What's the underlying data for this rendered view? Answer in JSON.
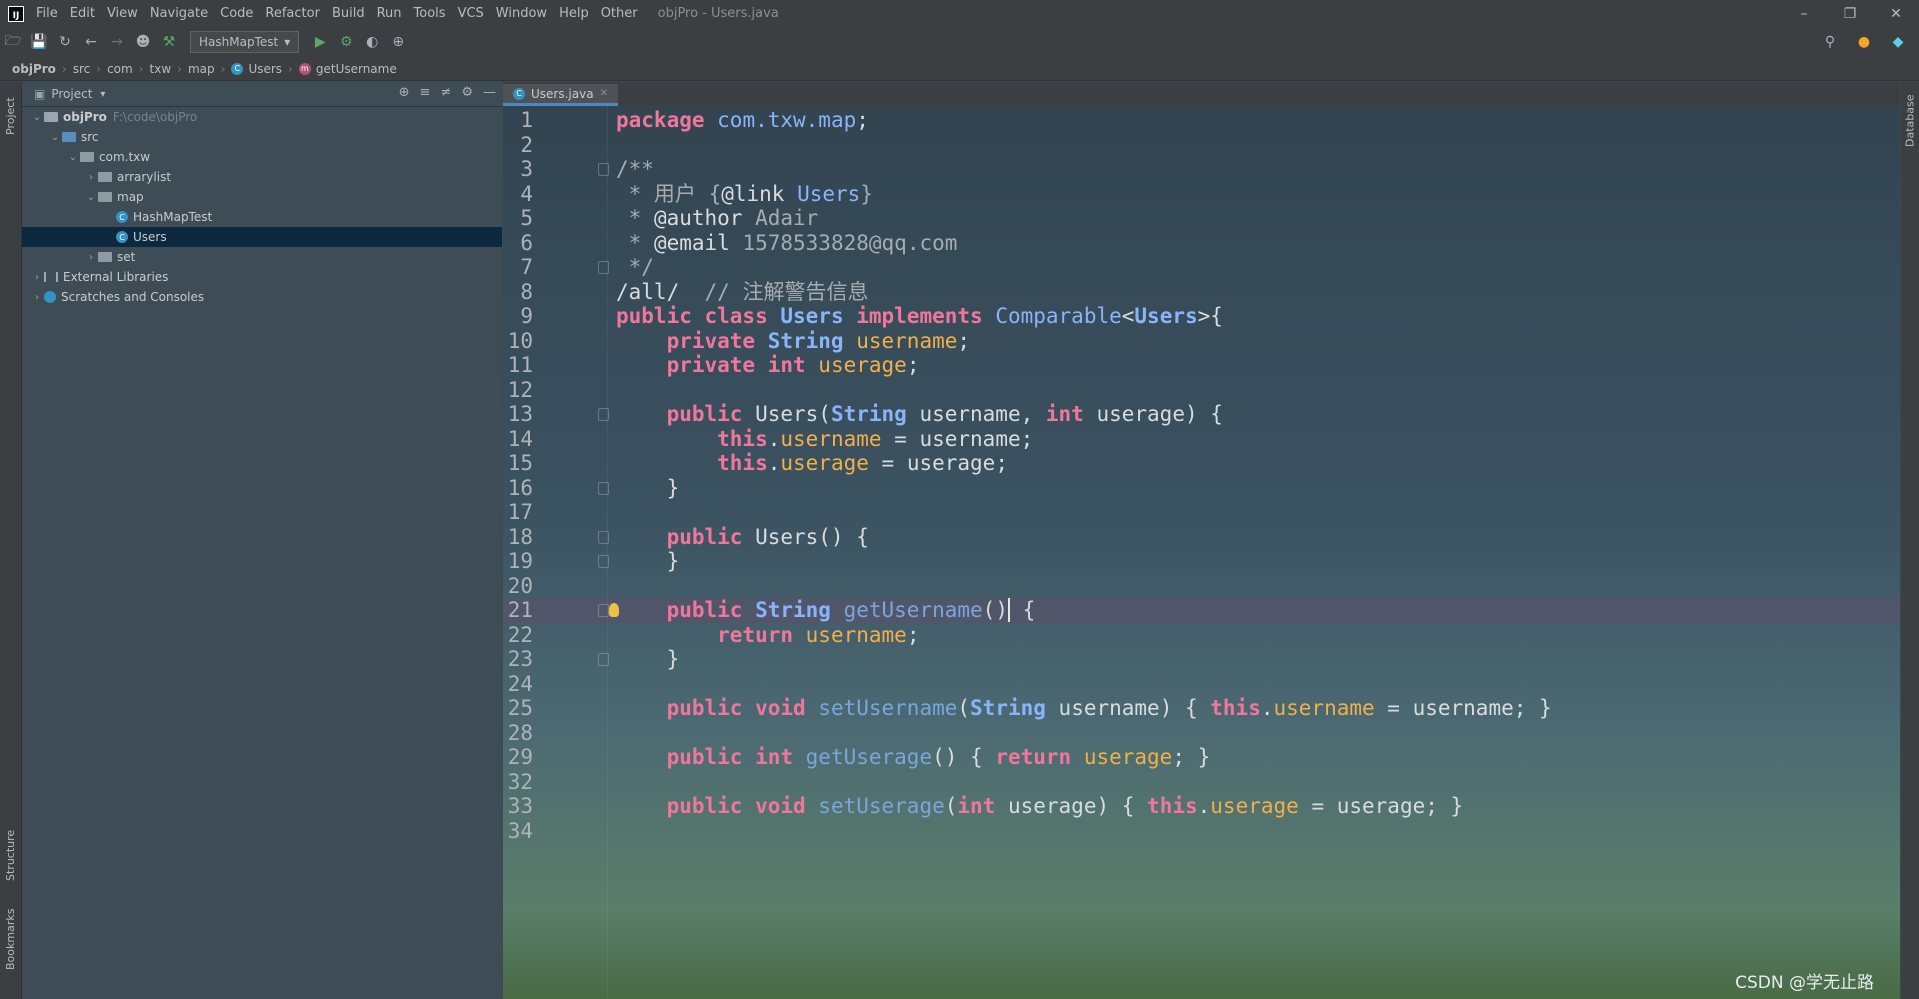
{
  "menubar": {
    "items": [
      "File",
      "Edit",
      "View",
      "Navigate",
      "Code",
      "Refactor",
      "Build",
      "Run",
      "Tools",
      "VCS",
      "Window",
      "Help",
      "Other"
    ],
    "title": "objPro - Users.java"
  },
  "toolbar": {
    "run_config": "HashMapTest"
  },
  "breadcrumb": [
    "objPro",
    "src",
    "com",
    "txw",
    "map",
    "Users",
    "getUsername"
  ],
  "sidebar": {
    "project_tab": "Project",
    "structure_tab": "Structure",
    "bookmarks_tab": "Bookmarks"
  },
  "right_bar": {
    "database_tab": "Database"
  },
  "project_panel": {
    "title": "Project",
    "tree": [
      {
        "label": "objPro",
        "hint": "F:\\code\\objPro",
        "depth": 0,
        "expanded": true,
        "kind": "project"
      },
      {
        "label": "src",
        "depth": 1,
        "expanded": true,
        "kind": "src"
      },
      {
        "label": "com.txw",
        "depth": 2,
        "expanded": true,
        "kind": "folder"
      },
      {
        "label": "arrarylist",
        "depth": 3,
        "expanded": false,
        "kind": "folder"
      },
      {
        "label": "map",
        "depth": 3,
        "expanded": true,
        "kind": "folder"
      },
      {
        "label": "HashMapTest",
        "depth": 4,
        "kind": "class"
      },
      {
        "label": "Users",
        "depth": 4,
        "kind": "class",
        "selected": true
      },
      {
        "label": "set",
        "depth": 3,
        "expanded": false,
        "kind": "folder"
      },
      {
        "label": "External Libraries",
        "depth": 0,
        "expanded": false,
        "kind": "lib"
      },
      {
        "label": "Scratches and Consoles",
        "depth": 0,
        "expanded": false,
        "kind": "scratch"
      }
    ]
  },
  "editor": {
    "tab": "Users.java",
    "lines": [
      {
        "n": "1",
        "segs": [
          [
            "kw",
            "package "
          ],
          [
            "pkg",
            "com.txw.map"
          ],
          [
            "",
            "; "
          ]
        ]
      },
      {
        "n": "2",
        "segs": []
      },
      {
        "n": "3",
        "fold": true,
        "segs": [
          [
            "com",
            "/**"
          ]
        ]
      },
      {
        "n": "4",
        "segs": [
          [
            "com",
            " * 用户 {"
          ],
          [
            "",
            "@link "
          ],
          [
            "lnk",
            "Users"
          ],
          [
            "com",
            "}"
          ]
        ]
      },
      {
        "n": "5",
        "segs": [
          [
            "com",
            " * "
          ],
          [
            "",
            "@author "
          ],
          [
            "com",
            "Adair"
          ]
        ]
      },
      {
        "n": "6",
        "segs": [
          [
            "com",
            " * "
          ],
          [
            "",
            "@email "
          ],
          [
            "com",
            "1578533828@qq.com"
          ]
        ]
      },
      {
        "n": "7",
        "fold": true,
        "segs": [
          [
            "com",
            " */"
          ]
        ]
      },
      {
        "n": "8",
        "segs": [
          [
            "",
            "/all/  "
          ],
          [
            "com",
            "// 注解警告信息"
          ]
        ]
      },
      {
        "n": "9",
        "segs": [
          [
            "kw",
            "public class "
          ],
          [
            "ty",
            "Users "
          ],
          [
            "kw",
            "implements "
          ],
          [
            "pkg",
            "Comparable"
          ],
          [
            "",
            "<"
          ],
          [
            "ty",
            "Users"
          ],
          [
            "",
            ">{"
          ]
        ]
      },
      {
        "n": "10",
        "segs": [
          [
            "kw",
            "    private "
          ],
          [
            "ty",
            "String "
          ],
          [
            "fld",
            "username"
          ],
          [
            "",
            ";"
          ]
        ]
      },
      {
        "n": "11",
        "segs": [
          [
            "kw",
            "    private int "
          ],
          [
            "fld",
            "userage"
          ],
          [
            "",
            ";"
          ]
        ]
      },
      {
        "n": "12",
        "segs": []
      },
      {
        "n": "13",
        "fold": true,
        "segs": [
          [
            "kw",
            "    public "
          ],
          [
            "",
            "Users("
          ],
          [
            "ty",
            "String "
          ],
          [
            "",
            "username, "
          ],
          [
            "kw",
            "int "
          ],
          [
            "",
            "userage) {"
          ]
        ]
      },
      {
        "n": "14",
        "segs": [
          [
            "kw",
            "        this"
          ],
          [
            "",
            "."
          ],
          [
            "fld",
            "username"
          ],
          [
            "",
            " = username;"
          ]
        ]
      },
      {
        "n": "15",
        "segs": [
          [
            "kw",
            "        this"
          ],
          [
            "",
            "."
          ],
          [
            "fld",
            "userage"
          ],
          [
            "",
            " = userage;"
          ]
        ]
      },
      {
        "n": "16",
        "fold": true,
        "segs": [
          [
            "",
            "    }"
          ]
        ]
      },
      {
        "n": "17",
        "segs": []
      },
      {
        "n": "18",
        "fold": true,
        "segs": [
          [
            "kw",
            "    public "
          ],
          [
            "",
            "Users() {"
          ]
        ]
      },
      {
        "n": "19",
        "fold": true,
        "segs": [
          [
            "",
            "    }"
          ]
        ]
      },
      {
        "n": "20",
        "segs": []
      },
      {
        "n": "21",
        "fold": true,
        "current": true,
        "bulb": true,
        "segs": [
          [
            "kw",
            "    public "
          ],
          [
            "ty",
            "String "
          ],
          [
            "fn",
            "getUsername"
          ],
          [
            "",
            "()"
          ],
          [
            "caret",
            ""
          ],
          [
            "",
            " {"
          ]
        ]
      },
      {
        "n": "22",
        "segs": [
          [
            "kw",
            "        return "
          ],
          [
            "fld",
            "username"
          ],
          [
            "",
            ";"
          ]
        ]
      },
      {
        "n": "23",
        "fold": true,
        "segs": [
          [
            "",
            "    }"
          ]
        ]
      },
      {
        "n": "24",
        "segs": []
      },
      {
        "n": "25",
        "segs": [
          [
            "kw",
            "    public void "
          ],
          [
            "fn",
            "setUsername"
          ],
          [
            "",
            "("
          ],
          [
            "ty",
            "String "
          ],
          [
            "",
            "username) { "
          ],
          [
            "kw",
            "this"
          ],
          [
            "",
            "."
          ],
          [
            "fld",
            "username"
          ],
          [
            "",
            " = username; }"
          ]
        ]
      },
      {
        "n": "28",
        "segs": []
      },
      {
        "n": "29",
        "segs": [
          [
            "kw",
            "    public int "
          ],
          [
            "fn",
            "getUserage"
          ],
          [
            "",
            "() { "
          ],
          [
            "kw",
            "return "
          ],
          [
            "fld",
            "userage"
          ],
          [
            "",
            "; }"
          ]
        ]
      },
      {
        "n": "32",
        "segs": []
      },
      {
        "n": "33",
        "segs": [
          [
            "kw",
            "    public void "
          ],
          [
            "fn",
            "setUserage"
          ],
          [
            "",
            "("
          ],
          [
            "kw",
            "int "
          ],
          [
            "",
            "userage) { "
          ],
          [
            "kw",
            "this"
          ],
          [
            "",
            "."
          ],
          [
            "fld",
            "userage"
          ],
          [
            "",
            " = userage; }"
          ]
        ]
      },
      {
        "n": "34",
        "segs": []
      }
    ]
  },
  "watermark": "CSDN @学无止路"
}
